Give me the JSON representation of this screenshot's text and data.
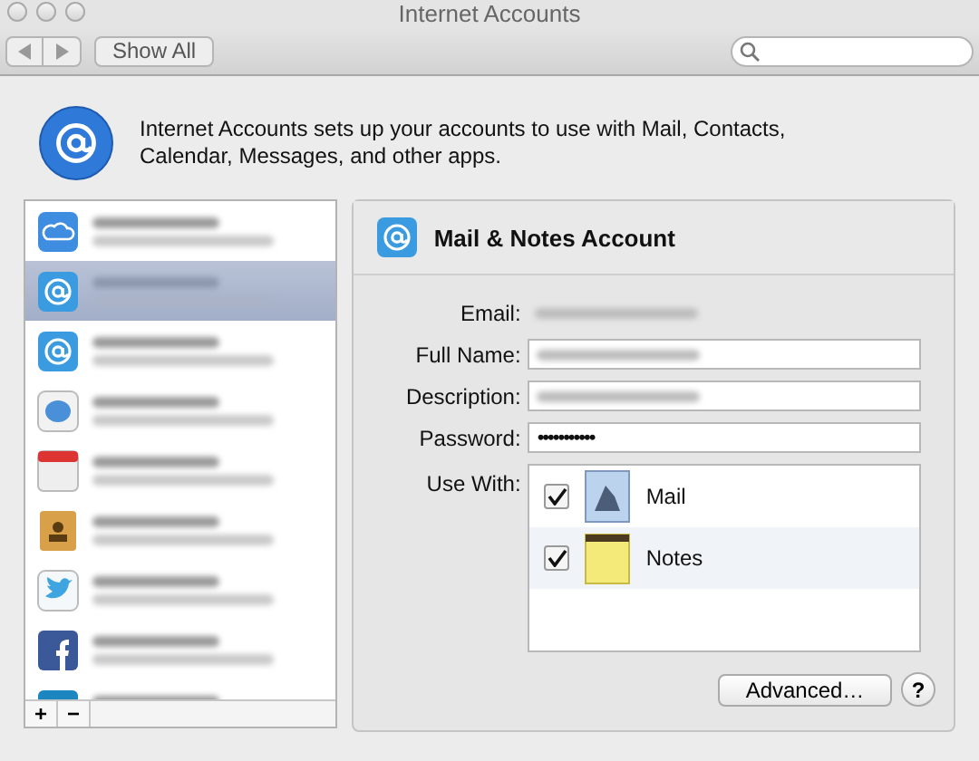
{
  "window": {
    "title": "Internet Accounts"
  },
  "toolbar": {
    "show_all": "Show All"
  },
  "header": {
    "text": "Internet Accounts sets up your accounts to use with Mail, Contacts, Calendar, Messages, and other apps."
  },
  "sidebar": {
    "items": [
      {
        "selected": false
      },
      {
        "selected": true
      },
      {
        "selected": false
      },
      {
        "selected": false
      },
      {
        "selected": false
      },
      {
        "selected": false
      },
      {
        "selected": false
      },
      {
        "selected": false
      },
      {
        "selected": false
      }
    ],
    "buttons": [
      "+",
      "−"
    ]
  },
  "account": {
    "title": "Mail & Notes Account",
    "fields": [
      {
        "kind": "plain",
        "label": "Email:"
      },
      {
        "kind": "input",
        "label": "Full Name:"
      },
      {
        "kind": "input",
        "label": "Description:"
      },
      {
        "kind": "input",
        "label": "Password:",
        "value": "•••••••••••"
      }
    ],
    "use_with_label": "Use With:",
    "apps": [
      {
        "name": "Mail",
        "checked": true
      },
      {
        "name": "Notes",
        "checked": true
      }
    ],
    "advanced": "Advanced…",
    "help": "?"
  }
}
